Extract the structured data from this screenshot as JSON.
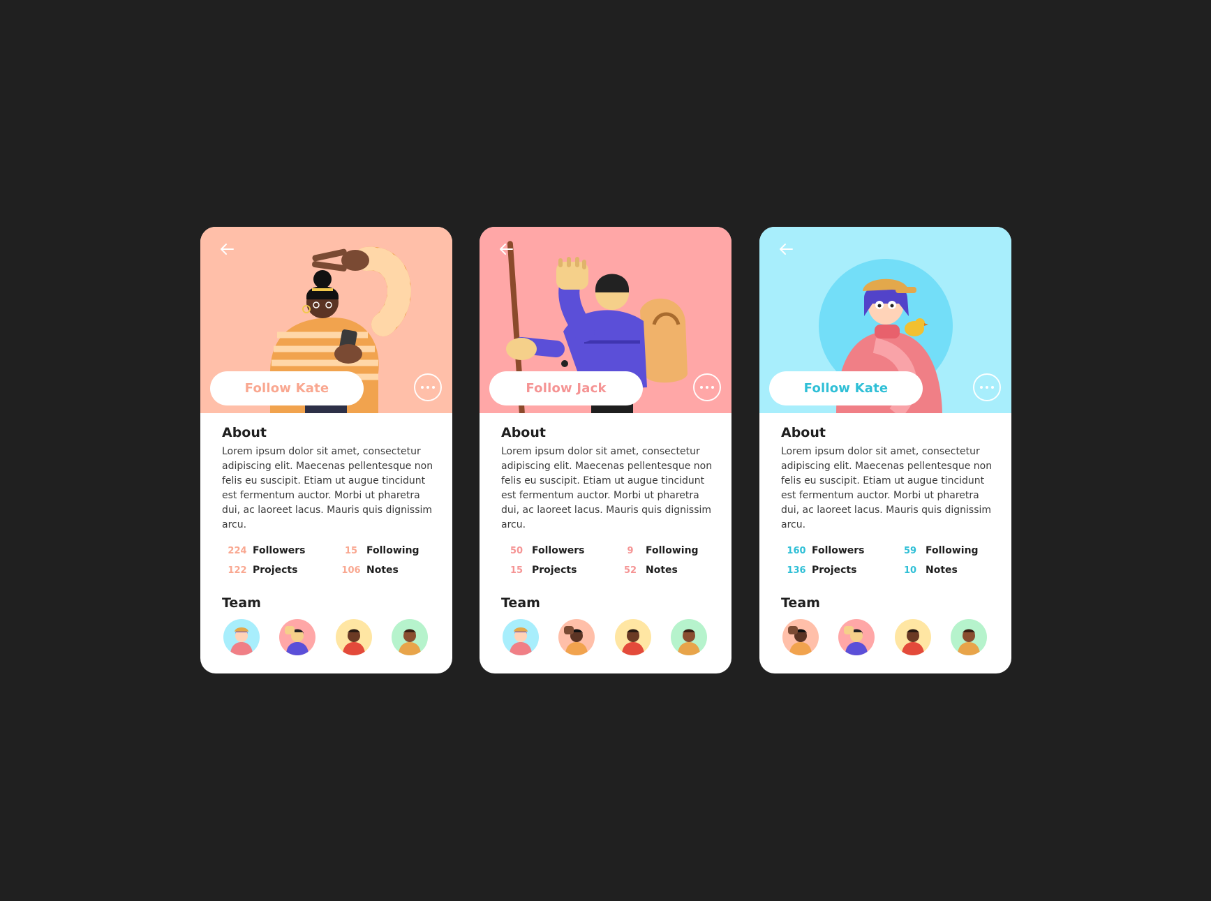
{
  "cards": [
    {
      "theme": {
        "hero_bg": "#ffbfa9",
        "accent": "#f9a790"
      },
      "follow_label": "Follow Kate",
      "about": {
        "title": "About",
        "text": "Lorem ipsum dolor sit amet, consectetur adipiscing elit. Maecenas pellentesque non felis eu suscipit. Etiam ut augue tincidunt est fermentum auctor. Morbi ut pharetra dui, ac laoreet lacus. Mauris quis dignissim arcu."
      },
      "stats": [
        {
          "value": "224",
          "label": "Followers"
        },
        {
          "value": "15",
          "label": "Following"
        },
        {
          "value": "122",
          "label": "Projects"
        },
        {
          "value": "106",
          "label": "Notes"
        }
      ],
      "team_title": "Team",
      "team": [
        "avatar-blue-girl",
        "avatar-pink-hiker",
        "avatar-yellow-man",
        "avatar-green-woman"
      ]
    },
    {
      "theme": {
        "hero_bg": "#ffa7a7",
        "accent": "#f59494"
      },
      "follow_label": "Follow  Jack",
      "about": {
        "title": "About",
        "text": "Lorem ipsum dolor sit amet, consectetur adipiscing elit. Maecenas pellentesque non felis eu suscipit. Etiam ut augue tincidunt est fermentum auctor. Morbi ut pharetra dui, ac laoreet lacus. Mauris quis dignissim arcu."
      },
      "stats": [
        {
          "value": "50",
          "label": "Followers"
        },
        {
          "value": "9",
          "label": "Following"
        },
        {
          "value": "15",
          "label": "Projects"
        },
        {
          "value": "52",
          "label": "Notes"
        }
      ],
      "team_title": "Team",
      "team": [
        "avatar-blue-girl",
        "avatar-peach-woman",
        "avatar-yellow-man",
        "avatar-green-woman"
      ]
    },
    {
      "theme": {
        "hero_bg": "#a8eefc",
        "accent": "#2fbfd6"
      },
      "follow_label": "Follow Kate",
      "about": {
        "title": "About",
        "text": "Lorem ipsum dolor sit amet, consectetur adipiscing elit. Maecenas pellentesque non felis eu suscipit. Etiam ut augue tincidunt est fermentum auctor. Morbi ut pharetra dui, ac laoreet lacus. Mauris quis dignissim arcu."
      },
      "stats": [
        {
          "value": "160",
          "label": "Followers"
        },
        {
          "value": "59",
          "label": "Following"
        },
        {
          "value": "136",
          "label": "Projects"
        },
        {
          "value": "10",
          "label": "Notes"
        }
      ],
      "team_title": "Team",
      "team": [
        "avatar-peach-woman",
        "avatar-pink-hiker",
        "avatar-yellow-man",
        "avatar-green-woman"
      ]
    }
  ]
}
